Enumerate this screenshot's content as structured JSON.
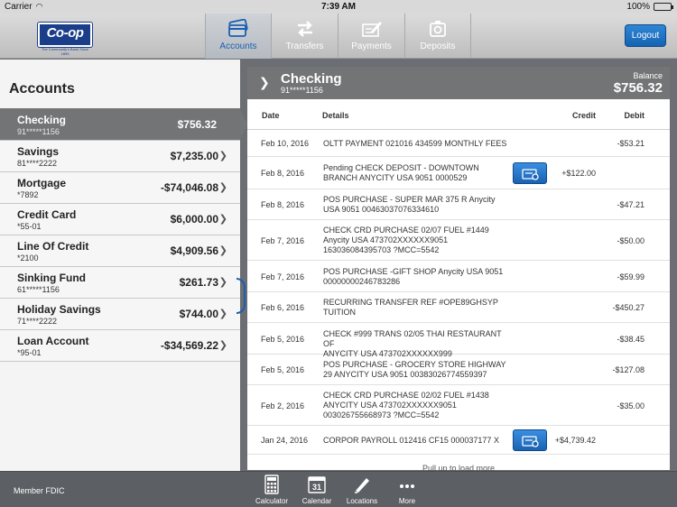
{
  "status": {
    "carrier": "Carrier",
    "time": "7:39 AM",
    "battery": "100%",
    "battery_level": 1.0
  },
  "logo": {
    "text": "Co-op",
    "tagline": "The Community's Bank Since 1899"
  },
  "nav": [
    {
      "label": "Accounts",
      "icon": "credit-cards-icon",
      "active": true
    },
    {
      "label": "Transfers",
      "icon": "transfer-arrows-icon"
    },
    {
      "label": "Payments",
      "icon": "payment-pen-icon"
    },
    {
      "label": "Deposits",
      "icon": "camera-icon"
    }
  ],
  "logout_label": "Logout",
  "accounts_title": "Accounts",
  "accounts": [
    {
      "name": "Checking",
      "number": "91*****1156",
      "balance": "$756.32",
      "active": true
    },
    {
      "name": "Savings",
      "number": "81****2222",
      "balance": "$7,235.00"
    },
    {
      "name": "Mortgage",
      "number": "*7892",
      "balance": "-$74,046.08"
    },
    {
      "name": "Credit Card",
      "number": "*55-01",
      "balance": "$6,000.00"
    },
    {
      "name": "Line Of Credit",
      "number": "*2100",
      "balance": "$4,909.56"
    },
    {
      "name": "Sinking Fund",
      "number": "61*****1156",
      "balance": "$261.73"
    },
    {
      "name": "Holiday Savings",
      "number": "71****2222",
      "balance": "$744.00"
    },
    {
      "name": "Loan Account",
      "number": "*95-01",
      "balance": "-$34,569.22"
    }
  ],
  "detail": {
    "title": "Checking",
    "number": "91*****1156",
    "balance_label": "Balance",
    "balance": "$756.32"
  },
  "table": {
    "headers": {
      "date": "Date",
      "details": "Details",
      "credit": "Credit",
      "debit": "Debit"
    },
    "rows": [
      {
        "date": "Feb 10, 2016",
        "details": [
          "OLTT PAYMENT 021016 434599 MONTHLY FEES"
        ],
        "credit": "",
        "debit": "-$53.21"
      },
      {
        "date": "Feb 8, 2016",
        "details": [
          "Pending CHECK DEPOSIT - DOWNTOWN",
          "BRANCH ANYCITY USA 9051 0000529"
        ],
        "credit": "+$122.00",
        "debit": "",
        "check": true
      },
      {
        "date": "Feb 8, 2016",
        "details": [
          "POS PURCHASE - SUPER MAR 375 R Anycity",
          "USA 9051 00463037076334610"
        ],
        "credit": "",
        "debit": "-$47.21"
      },
      {
        "date": "Feb 7, 2016",
        "details": [
          "CHECK CRD PURCHASE 02/07 FUEL #1449",
          "Anycity USA 473702XXXXXX9051",
          "163036084395703 ?MCC=5542"
        ],
        "credit": "",
        "debit": "-$50.00"
      },
      {
        "date": "Feb 7, 2016",
        "details": [
          "POS PURCHASE -GIFT SHOP Anycity USA 9051",
          "00000000246783286"
        ],
        "credit": "",
        "debit": "-$59.99"
      },
      {
        "date": "Feb 6, 2016",
        "details": [
          "RECURRING TRANSFER REF #OPE89GHSYP",
          "TUITION"
        ],
        "credit": "",
        "debit": "-$450.27"
      },
      {
        "date": "Feb 5, 2016",
        "details": [
          "CHECK #999 TRANS 02/05 THAI RESTAURANT OF",
          "ANYCITY USA 473702XXXXXX999"
        ],
        "credit": "",
        "debit": "-$38.45"
      },
      {
        "date": "Feb 5, 2016",
        "details": [
          "POS PURCHASE - GROCERY STORE HIGHWAY",
          "29 ANYCITY USA 9051 00383026774559397"
        ],
        "credit": "",
        "debit": "-$127.08"
      },
      {
        "date": "Feb 2, 2016",
        "details": [
          "CHECK CRD PURCHASE 02/02 FUEL #1438",
          "ANYCITY USA 473702XXXXXX9051",
          "003026755668973 ?MCC=5542"
        ],
        "credit": "",
        "debit": "-$35.00"
      },
      {
        "date": "Jan 24, 2016",
        "details": [
          "CORPOR PAYROLL 012416 CF15 000037177 X"
        ],
        "credit": "+$4,739.42",
        "debit": "",
        "check": true
      }
    ],
    "more_text": "Pull up to load more"
  },
  "footer": {
    "fdic": "Member FDIC",
    "tools": [
      {
        "label": "Calculator",
        "icon": "calculator-icon"
      },
      {
        "label": "Calendar",
        "icon": "calendar-icon",
        "day": "31"
      },
      {
        "label": "Locations",
        "icon": "location-pin-icon"
      },
      {
        "label": "More",
        "icon": "more-dots-icon"
      }
    ]
  }
}
